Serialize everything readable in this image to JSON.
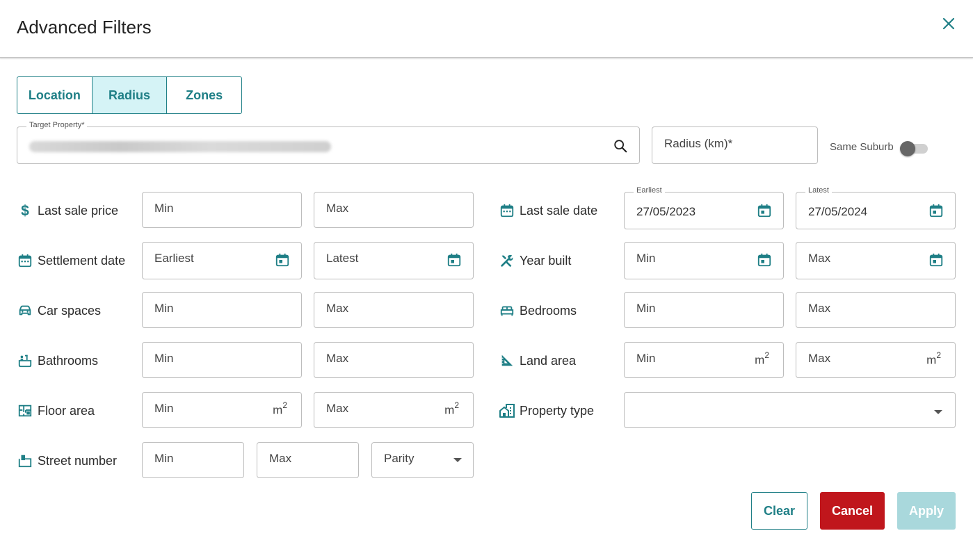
{
  "dialog": {
    "title": "Advanced Filters"
  },
  "tabs": [
    {
      "label": "Location"
    },
    {
      "label": "Radius"
    },
    {
      "label": "Zones"
    }
  ],
  "target_property": {
    "legend": "Target Property*"
  },
  "radius": {
    "placeholder": "Radius (km)*"
  },
  "same_suburb": {
    "label": "Same Suburb",
    "checked": false
  },
  "placeholders": {
    "min": "Min",
    "max": "Max",
    "earliest": "Earliest",
    "latest": "Latest",
    "parity": "Parity",
    "unit_base": "m",
    "unit_exp": "2"
  },
  "filters": {
    "last_sale_price": {
      "label": "Last sale price",
      "icon": "dollar-icon"
    },
    "settlement_date": {
      "label": "Settlement date",
      "icon": "calendar-icon"
    },
    "car_spaces": {
      "label": "Car spaces",
      "icon": "car-icon"
    },
    "bathrooms": {
      "label": "Bathrooms",
      "icon": "bathtub-icon"
    },
    "floor_area": {
      "label": "Floor area",
      "icon": "floor-plan-icon"
    },
    "street_number": {
      "label": "Street number",
      "icon": "door-number-icon"
    },
    "last_sale_date": {
      "label": "Last sale date",
      "icon": "calendar-icon",
      "earliest_legend": "Earliest",
      "earliest_value": "27/05/2023",
      "latest_legend": "Latest",
      "latest_value": "27/05/2024"
    },
    "year_built": {
      "label": "Year built",
      "icon": "tools-icon"
    },
    "bedrooms": {
      "label": "Bedrooms",
      "icon": "bed-icon"
    },
    "land_area": {
      "label": "Land area",
      "icon": "set-square-icon"
    },
    "property_type": {
      "label": "Property type",
      "icon": "house-building-icon",
      "value": ""
    }
  },
  "actions": {
    "clear": "Clear",
    "cancel": "Cancel",
    "apply": "Apply"
  },
  "colors": {
    "accent": "#1f7f86",
    "cancel": "#c0161c",
    "apply_disabled": "#a9d8dc",
    "active_tab": "#d5f3f6"
  }
}
